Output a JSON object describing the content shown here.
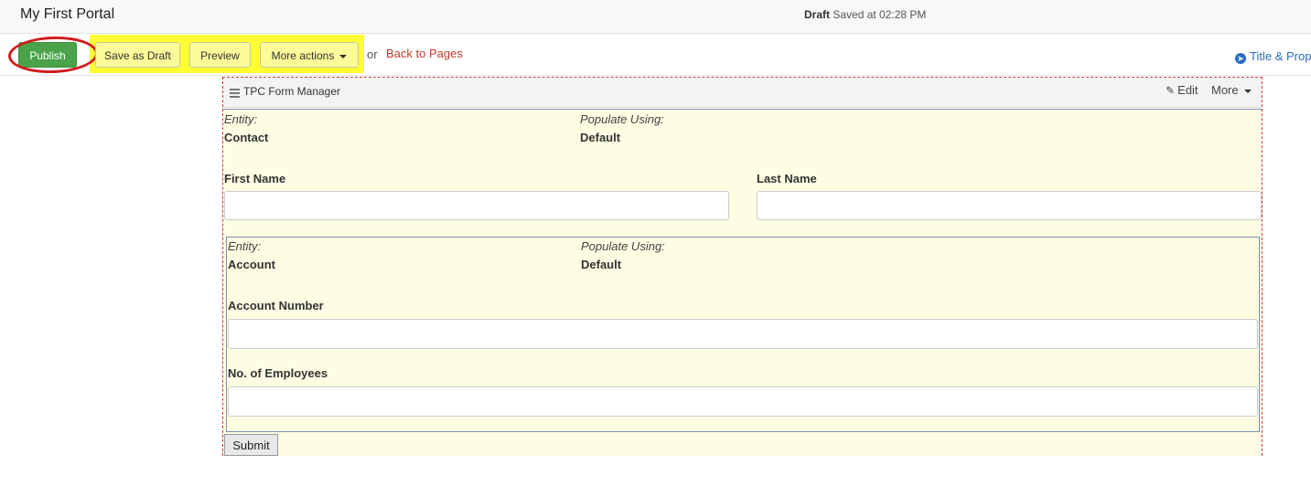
{
  "header": {
    "portal_title": "My First Portal",
    "status_label": "Draft",
    "saved_text": "Saved at 02:28 PM"
  },
  "toolbar": {
    "publish_label": "Publish",
    "save_draft_label": "Save as Draft",
    "preview_label": "Preview",
    "more_actions_label": "More actions",
    "or_text": "or",
    "back_link_label": "Back to Pages",
    "title_properties_label": "Title & Prop"
  },
  "widget": {
    "title": "TPC Form Manager",
    "edit_label": "Edit",
    "more_label": "More"
  },
  "form": {
    "entity_label": "Entity:",
    "entity_value": "Contact",
    "populate_label": "Populate Using:",
    "populate_value": "Default",
    "first_name_label": "First Name",
    "first_name_value": "",
    "last_name_label": "Last Name",
    "last_name_value": "",
    "sub_form": {
      "entity_label": "Entity:",
      "entity_value": "Account",
      "populate_label": "Populate Using:",
      "populate_value": "Default",
      "account_number_label": "Account Number",
      "account_number_value": "",
      "employees_label": "No. of Employees",
      "employees_value": ""
    },
    "submit_label": "Submit"
  },
  "colors": {
    "publish_green": "#4aa34a",
    "highlight_yellow": "#ffff33",
    "annotation_red": "#d01c1c",
    "form_background": "#fdfde3",
    "link_red": "#c0392b",
    "link_blue": "#2a6ebb"
  },
  "icons": [
    "hamburger-icon",
    "pencil-icon",
    "caret-down-icon",
    "circle-arrow-right-icon"
  ]
}
